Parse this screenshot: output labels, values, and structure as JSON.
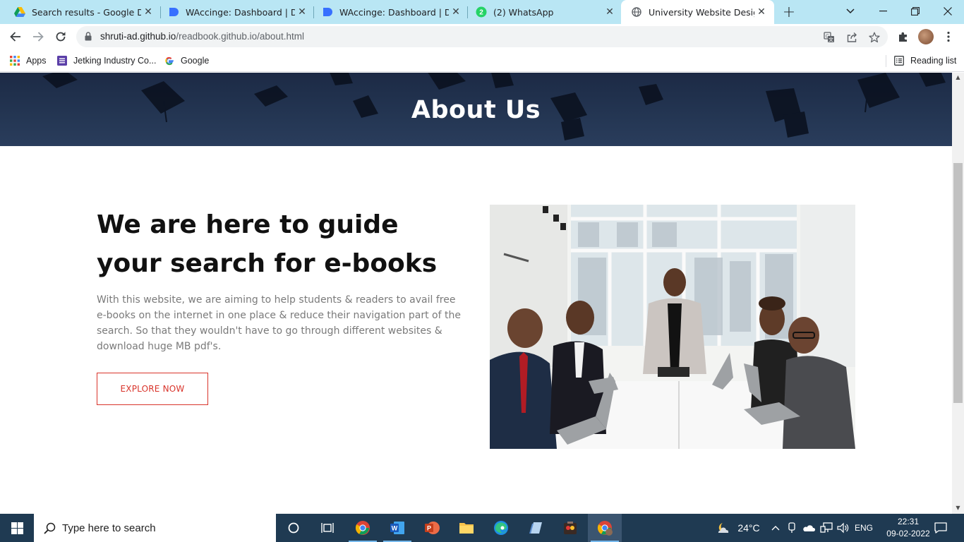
{
  "browser": {
    "tabs": [
      {
        "label": "Search results - Google Drive",
        "icon": "google-drive-icon",
        "active": false
      },
      {
        "label": "WAccinge: Dashboard | Devfo",
        "icon": "devfolio-icon",
        "active": false
      },
      {
        "label": "WAccinge: Dashboard | Devfo",
        "icon": "devfolio-icon",
        "active": false
      },
      {
        "label": "(2) WhatsApp",
        "icon": "whatsapp-icon",
        "badge": "2",
        "active": false
      },
      {
        "label": "University Website Design - I",
        "icon": "globe-icon",
        "active": true
      }
    ],
    "url_host": "shruti-ad.github.io",
    "url_path": "/readbook.github.io/about.html",
    "bookmarks": [
      {
        "label": "Apps",
        "icon": "apps-grid-icon"
      },
      {
        "label": "Jetking Industry Co...",
        "icon": "jetking-icon"
      },
      {
        "label": "Google",
        "icon": "google-icon"
      }
    ],
    "reading_list": "Reading list"
  },
  "page": {
    "hero_title": "About Us",
    "headline": "We are here to guide your search for e-books",
    "description": "With this website, we are aiming to help students & readers to avail free e-books on the internet in one place & reduce their navigation part of the search. So that they wouldn't have to go through different websites & download huge MB pdf's.",
    "cta_label": "EXPLORE NOW",
    "colors": {
      "accent": "#d9342b",
      "hero": "#1c2a45"
    }
  },
  "taskbar": {
    "search_placeholder": "Type here to search",
    "weather": "24°C",
    "language": "ENG",
    "time": "22:31",
    "date": "09-02-2022"
  }
}
